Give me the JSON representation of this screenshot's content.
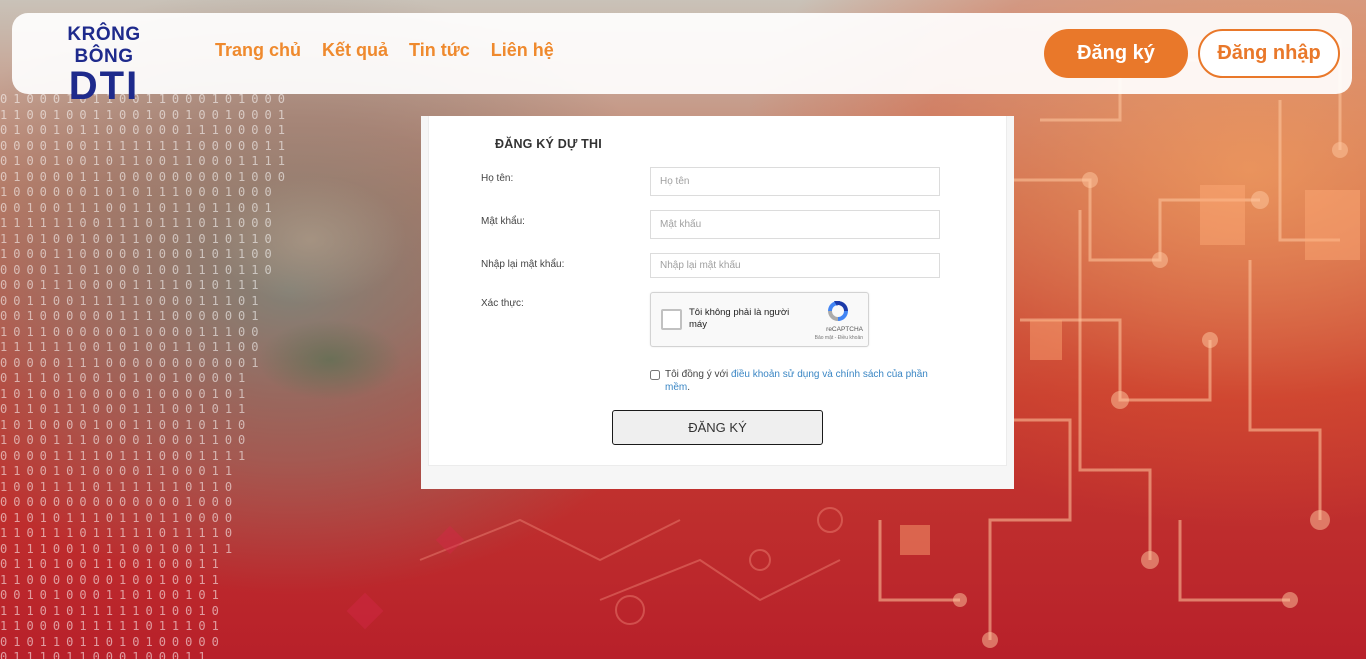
{
  "header": {
    "logo_top": "KRÔNG BÔNG",
    "logo_main": "DTI",
    "nav": [
      "Trang chủ",
      "Kết quả",
      "Tin tức",
      "Liên hệ"
    ],
    "register_button": "Đăng ký",
    "login_button": "Đăng nhập"
  },
  "form": {
    "title": "ĐĂNG KÝ DỰ THI",
    "fields": [
      {
        "label": "Họ tên:",
        "placeholder": "Họ tên",
        "value": ""
      },
      {
        "label": "Mật khẩu:",
        "placeholder": "Mật khẩu",
        "value": ""
      },
      {
        "label": "Nhập lại mật khẩu:",
        "placeholder": "Nhập lại mật khẩu",
        "value": ""
      }
    ],
    "verify_label": "Xác thực:",
    "recaptcha": {
      "checkbox_text": "Tôi không phải là người máy",
      "brand": "reCAPTCHA",
      "links": "Bảo mật - Điều khoản"
    },
    "agree_prefix": "Tôi đồng ý với ",
    "agree_link": "điều khoản sử dụng và chính sách của phần mềm",
    "agree_suffix": ".",
    "submit_button": "ĐĂNG KÝ"
  },
  "colors": {
    "brand_blue": "#1e2a8c",
    "accent_orange": "#e9782a",
    "link_blue": "#3a86c4"
  }
}
